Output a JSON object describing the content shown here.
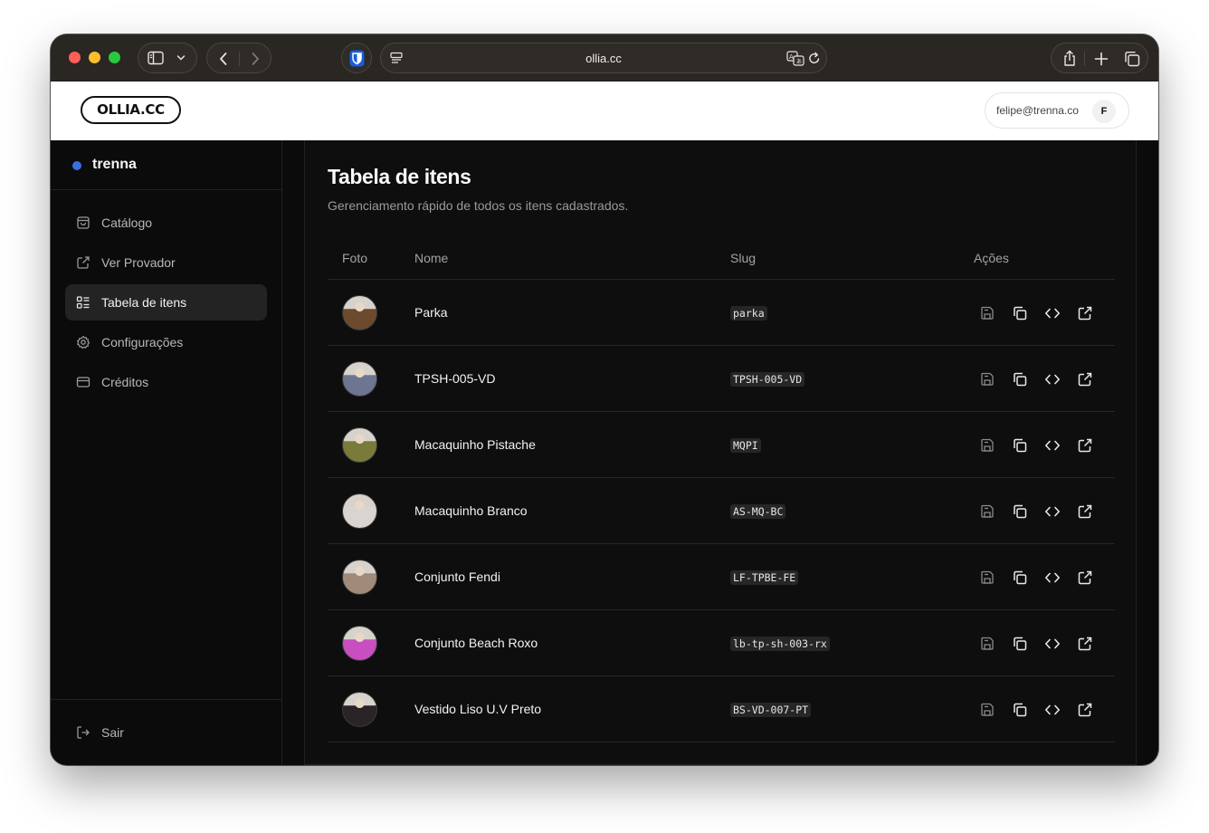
{
  "browser": {
    "url": "ollia.cc"
  },
  "header": {
    "logo": "OLLIA.CC",
    "user_email": "felipe@trenna.co",
    "user_initial": "F"
  },
  "sidebar": {
    "org_name": "trenna",
    "org_dot_color": "#3b6fe0",
    "items": [
      {
        "label": "Catálogo",
        "icon": "shopping-bag-icon"
      },
      {
        "label": "Ver Provador",
        "icon": "external-link-icon"
      },
      {
        "label": "Tabela de itens",
        "icon": "list-icon",
        "active": true
      },
      {
        "label": "Configurações",
        "icon": "gear-icon"
      },
      {
        "label": "Créditos",
        "icon": "credit-card-icon"
      }
    ],
    "logout_label": "Sair"
  },
  "main": {
    "title": "Tabela de itens",
    "subtitle": "Gerenciamento rápido de todos os itens cadastrados.",
    "columns": [
      "Foto",
      "Nome",
      "Slug",
      "Ações"
    ],
    "rows": [
      {
        "name": "Parka",
        "slug": "parka",
        "photo_color": "#6b4a2e"
      },
      {
        "name": "TPSH-005-VD",
        "slug": "TPSH-005-VD",
        "photo_color": "#6e7590"
      },
      {
        "name": "Macaquinho Pistache",
        "slug": "MQPI",
        "photo_color": "#7a7a3a"
      },
      {
        "name": "Macaquinho Branco",
        "slug": "AS-MQ-BC",
        "photo_color": "#d9d4cf"
      },
      {
        "name": "Conjunto Fendi",
        "slug": "LF-TPBE-FE",
        "photo_color": "#a08a78"
      },
      {
        "name": "Conjunto Beach Roxo",
        "slug": "lb-tp-sh-003-rx",
        "photo_color": "#c84fbf"
      },
      {
        "name": "Vestido Liso U.V Preto",
        "slug": "BS-VD-007-PT",
        "photo_color": "#2a2426"
      }
    ],
    "row_actions": [
      "save-icon",
      "copy-icon",
      "code-icon",
      "external-link-icon"
    ]
  }
}
